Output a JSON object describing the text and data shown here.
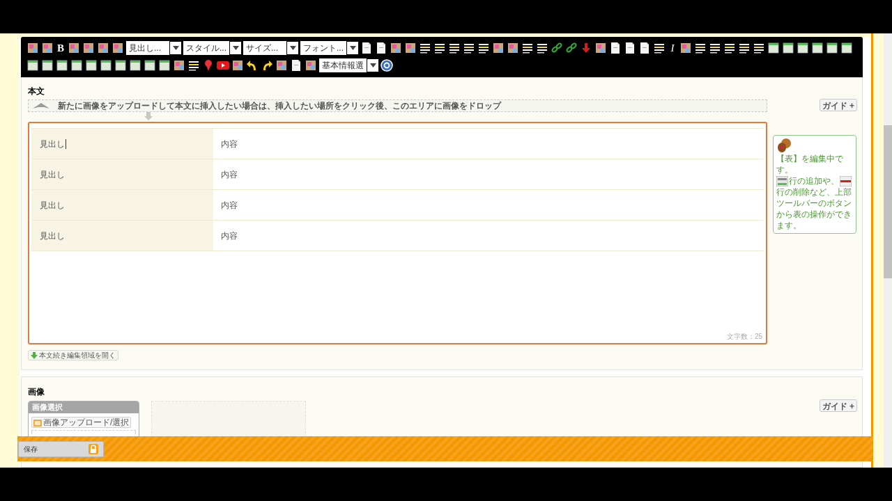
{
  "toolbar": {
    "rows": [
      [
        {
          "kind": "tool"
        },
        {
          "kind": "tool"
        },
        {
          "kind": "glyph",
          "text": "B"
        },
        {
          "kind": "tool"
        },
        {
          "kind": "tool"
        },
        {
          "kind": "tool"
        },
        {
          "kind": "tool"
        },
        {
          "kind": "dropdown",
          "text": "見出し..."
        },
        {
          "kind": "dropdown",
          "text": "スタイル..."
        },
        {
          "kind": "dropdown",
          "text": "サイズ..."
        },
        {
          "kind": "dropdown",
          "text": "フォント..."
        },
        {
          "kind": "page"
        },
        {
          "kind": "page"
        },
        {
          "kind": "tool"
        },
        {
          "kind": "tool"
        },
        {
          "kind": "lines"
        },
        {
          "kind": "lines"
        },
        {
          "kind": "lines"
        },
        {
          "kind": "lines"
        },
        {
          "kind": "lines"
        },
        {
          "kind": "tool"
        },
        {
          "kind": "tool"
        },
        {
          "kind": "lines"
        },
        {
          "kind": "lines"
        },
        {
          "kind": "link"
        },
        {
          "kind": "link"
        },
        {
          "kind": "anchor"
        },
        {
          "kind": "tool"
        },
        {
          "kind": "page"
        },
        {
          "kind": "page"
        },
        {
          "kind": "page"
        },
        {
          "kind": "lines"
        },
        {
          "kind": "glyph",
          "text": "I"
        },
        {
          "kind": "tool"
        },
        {
          "kind": "lines"
        },
        {
          "kind": "lines"
        },
        {
          "kind": "lines"
        },
        {
          "kind": "lines"
        },
        {
          "kind": "lines"
        },
        {
          "kind": "table"
        },
        {
          "kind": "table"
        },
        {
          "kind": "table"
        },
        {
          "kind": "table"
        },
        {
          "kind": "table"
        },
        {
          "kind": "table"
        }
      ],
      [
        {
          "kind": "table"
        },
        {
          "kind": "table"
        },
        {
          "kind": "table"
        },
        {
          "kind": "table"
        },
        {
          "kind": "table"
        },
        {
          "kind": "table"
        },
        {
          "kind": "table"
        },
        {
          "kind": "table"
        },
        {
          "kind": "table"
        },
        {
          "kind": "table"
        },
        {
          "kind": "tool"
        },
        {
          "kind": "lines"
        },
        {
          "kind": "pin"
        },
        {
          "kind": "play"
        },
        {
          "kind": "tool"
        },
        {
          "kind": "arrow"
        },
        {
          "kind": "arrow"
        },
        {
          "kind": "tool"
        },
        {
          "kind": "page"
        },
        {
          "kind": "tool"
        },
        {
          "kind": "dropdown",
          "text": "基本情報選"
        },
        {
          "kind": "help"
        }
      ]
    ]
  },
  "body_section": {
    "title": "本文",
    "drop_hint": "新たに画像をアップロードして本文に挿入したい場合は、挿入したい場所をクリック後、このエリアに画像をドロップ",
    "guide_button": "ガイド +",
    "table_rows": [
      {
        "heading": "見出し",
        "content": "内容",
        "focused": true
      },
      {
        "heading": "見出し",
        "content": "内容",
        "focused": false
      },
      {
        "heading": "見出し",
        "content": "内容",
        "focused": false
      },
      {
        "heading": "見出し",
        "content": "内容",
        "focused": false
      }
    ],
    "char_count": "文字数：25",
    "expand_button": "本文続き編集領域を開く",
    "tooltip": {
      "parts": [
        "【表】を編集中です。",
        "行の追加や、",
        "行の削除など、上部ツールバーのボタンから表の操作ができます。"
      ]
    }
  },
  "image_section": {
    "title": "画像",
    "guide_button": "ガイド +",
    "panel_title": "画像選択",
    "upload_button": "画像アップロード/選択"
  },
  "save_bar": {
    "save_button": "保存"
  }
}
